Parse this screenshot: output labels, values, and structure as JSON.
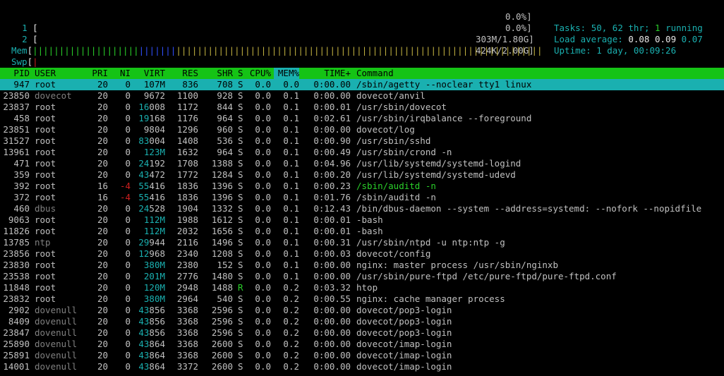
{
  "meters": {
    "cpu1": {
      "label": "1",
      "open": "[",
      "value": "0.0%]"
    },
    "cpu2": {
      "label": "2",
      "open": "[",
      "value": "0.0%]"
    },
    "mem": {
      "label": "Mem",
      "open": "[",
      "bars_green": "||||||||||||||||||||",
      "bars_blue": "|||||||",
      "bars_yellow": "|||||||||||||||||||||||||||||||||||||||||||||||||||||||||||||||||||||",
      "value": "303M/1.80G]"
    },
    "swp": {
      "label": "Swp",
      "open": "[",
      "bars_red": "|",
      "value": "424K/2.00G]"
    }
  },
  "stats": {
    "tasks_label": "Tasks: ",
    "tasks_value": "50, ",
    "thr_value": "62",
    "thr_label": " thr; ",
    "running_value": "1",
    "running_label": " running",
    "load_label": "Load average: ",
    "load1": "0.08",
    "load5": "0.09",
    "load15": "0.07",
    "uptime_label": "Uptime: ",
    "uptime_value": "1 day, 00:09:26"
  },
  "header": {
    "pid": "PID",
    "user": "USER",
    "pri": "PRI",
    "ni": "NI",
    "virt": "VIRT",
    "res": "RES",
    "shr": "SHR",
    "s": "S",
    "cpu": "CPU%",
    "mem": "MEM%",
    "time": "TIME+",
    "cmd": "Command"
  },
  "processes": [
    {
      "pid": "947",
      "user": "root",
      "pri": "20",
      "ni": "0",
      "virt": "107M",
      "res": "836",
      "shr": "708",
      "s": "S",
      "cpu": "0.0",
      "mem": "0.0",
      "time": "0:00.00",
      "cmd": "/sbin/agetty --noclear tty1 linux"
    },
    {
      "pid": "23850",
      "user": "dovecot",
      "pri": "20",
      "ni": "0",
      "virt": "9672",
      "res": "1100",
      "shr": "928",
      "s": "S",
      "cpu": "0.0",
      "mem": "0.1",
      "time": "0:00.00",
      "cmd": "dovecot/anvil"
    },
    {
      "pid": "23837",
      "user": "root",
      "pri": "20",
      "ni": "0",
      "virt": "16008",
      "res": "1172",
      "shr": "844",
      "s": "S",
      "cpu": "0.0",
      "mem": "0.1",
      "time": "0:00.01",
      "cmd": "/usr/sbin/dovecot"
    },
    {
      "pid": "458",
      "user": "root",
      "pri": "20",
      "ni": "0",
      "virt": "19168",
      "res": "1176",
      "shr": "964",
      "s": "S",
      "cpu": "0.0",
      "mem": "0.1",
      "time": "0:02.61",
      "cmd": "/usr/sbin/irqbalance --foreground"
    },
    {
      "pid": "23851",
      "user": "root",
      "pri": "20",
      "ni": "0",
      "virt": "9804",
      "res": "1296",
      "shr": "960",
      "s": "S",
      "cpu": "0.0",
      "mem": "0.1",
      "time": "0:00.00",
      "cmd": "dovecot/log"
    },
    {
      "pid": "31527",
      "user": "root",
      "pri": "20",
      "ni": "0",
      "virt": "83004",
      "res": "1408",
      "shr": "536",
      "s": "S",
      "cpu": "0.0",
      "mem": "0.1",
      "time": "0:00.90",
      "cmd": "/usr/sbin/sshd"
    },
    {
      "pid": "13961",
      "user": "root",
      "pri": "20",
      "ni": "0",
      "virt": "123M",
      "res": "1632",
      "shr": "964",
      "s": "S",
      "cpu": "0.0",
      "mem": "0.1",
      "time": "0:00.49",
      "cmd": "/usr/sbin/crond -n"
    },
    {
      "pid": "471",
      "user": "root",
      "pri": "20",
      "ni": "0",
      "virt": "24192",
      "res": "1708",
      "shr": "1388",
      "s": "S",
      "cpu": "0.0",
      "mem": "0.1",
      "time": "0:04.96",
      "cmd": "/usr/lib/systemd/systemd-logind"
    },
    {
      "pid": "359",
      "user": "root",
      "pri": "20",
      "ni": "0",
      "virt": "43472",
      "res": "1772",
      "shr": "1284",
      "s": "S",
      "cpu": "0.0",
      "mem": "0.1",
      "time": "0:00.20",
      "cmd": "/usr/lib/systemd/systemd-udevd"
    },
    {
      "pid": "392",
      "user": "root",
      "pri": "16",
      "ni": "-4",
      "virt": "55416",
      "res": "1836",
      "shr": "1396",
      "s": "S",
      "cpu": "0.0",
      "mem": "0.1",
      "time": "0:00.23",
      "cmd": "/sbin/auditd -n"
    },
    {
      "pid": "372",
      "user": "root",
      "pri": "16",
      "ni": "-4",
      "virt": "55416",
      "res": "1836",
      "shr": "1396",
      "s": "S",
      "cpu": "0.0",
      "mem": "0.1",
      "time": "0:01.76",
      "cmd": "/sbin/auditd -n"
    },
    {
      "pid": "460",
      "user": "dbus",
      "pri": "20",
      "ni": "0",
      "virt": "24528",
      "res": "1904",
      "shr": "1332",
      "s": "S",
      "cpu": "0.0",
      "mem": "0.1",
      "time": "0:12.43",
      "cmd": "/bin/dbus-daemon --system --address=systemd: --nofork --nopidfile"
    },
    {
      "pid": "9063",
      "user": "root",
      "pri": "20",
      "ni": "0",
      "virt": "112M",
      "res": "1988",
      "shr": "1612",
      "s": "S",
      "cpu": "0.0",
      "mem": "0.1",
      "time": "0:00.01",
      "cmd": "-bash"
    },
    {
      "pid": "11826",
      "user": "root",
      "pri": "20",
      "ni": "0",
      "virt": "112M",
      "res": "2032",
      "shr": "1656",
      "s": "S",
      "cpu": "0.0",
      "mem": "0.1",
      "time": "0:00.01",
      "cmd": "-bash"
    },
    {
      "pid": "13785",
      "user": "ntp",
      "pri": "20",
      "ni": "0",
      "virt": "29944",
      "res": "2116",
      "shr": "1496",
      "s": "S",
      "cpu": "0.0",
      "mem": "0.1",
      "time": "0:00.31",
      "cmd": "/usr/sbin/ntpd -u ntp:ntp -g"
    },
    {
      "pid": "23856",
      "user": "root",
      "pri": "20",
      "ni": "0",
      "virt": "12968",
      "res": "2340",
      "shr": "1208",
      "s": "S",
      "cpu": "0.0",
      "mem": "0.1",
      "time": "0:00.03",
      "cmd": "dovecot/config"
    },
    {
      "pid": "23830",
      "user": "root",
      "pri": "20",
      "ni": "0",
      "virt": "380M",
      "res": "2380",
      "shr": "152",
      "s": "S",
      "cpu": "0.0",
      "mem": "0.1",
      "time": "0:00.00",
      "cmd": "nginx: master process /usr/sbin/nginxb"
    },
    {
      "pid": "23538",
      "user": "root",
      "pri": "20",
      "ni": "0",
      "virt": "201M",
      "res": "2776",
      "shr": "1480",
      "s": "S",
      "cpu": "0.0",
      "mem": "0.1",
      "time": "0:00.00",
      "cmd": "/usr/sbin/pure-ftpd /etc/pure-ftpd/pure-ftpd.conf"
    },
    {
      "pid": "11848",
      "user": "root",
      "pri": "20",
      "ni": "0",
      "virt": "120M",
      "res": "2948",
      "shr": "1488",
      "s": "R",
      "cpu": "0.0",
      "mem": "0.2",
      "time": "0:03.32",
      "cmd": "htop"
    },
    {
      "pid": "23832",
      "user": "root",
      "pri": "20",
      "ni": "0",
      "virt": "380M",
      "res": "2964",
      "shr": "540",
      "s": "S",
      "cpu": "0.0",
      "mem": "0.2",
      "time": "0:00.55",
      "cmd": "nginx: cache manager process"
    },
    {
      "pid": "2902",
      "user": "dovenull",
      "pri": "20",
      "ni": "0",
      "virt": "43856",
      "res": "3368",
      "shr": "2596",
      "s": "S",
      "cpu": "0.0",
      "mem": "0.2",
      "time": "0:00.00",
      "cmd": "dovecot/pop3-login"
    },
    {
      "pid": "8409",
      "user": "dovenull",
      "pri": "20",
      "ni": "0",
      "virt": "43856",
      "res": "3368",
      "shr": "2596",
      "s": "S",
      "cpu": "0.0",
      "mem": "0.2",
      "time": "0:00.00",
      "cmd": "dovecot/pop3-login"
    },
    {
      "pid": "23847",
      "user": "dovenull",
      "pri": "20",
      "ni": "0",
      "virt": "43856",
      "res": "3368",
      "shr": "2596",
      "s": "S",
      "cpu": "0.0",
      "mem": "0.2",
      "time": "0:00.00",
      "cmd": "dovecot/pop3-login"
    },
    {
      "pid": "25890",
      "user": "dovenull",
      "pri": "20",
      "ni": "0",
      "virt": "43864",
      "res": "3368",
      "shr": "2600",
      "s": "S",
      "cpu": "0.0",
      "mem": "0.2",
      "time": "0:00.00",
      "cmd": "dovecot/imap-login"
    },
    {
      "pid": "25891",
      "user": "dovenull",
      "pri": "20",
      "ni": "0",
      "virt": "43864",
      "res": "3368",
      "shr": "2600",
      "s": "S",
      "cpu": "0.0",
      "mem": "0.2",
      "time": "0:00.00",
      "cmd": "dovecot/imap-login"
    },
    {
      "pid": "14001",
      "user": "dovenull",
      "pri": "20",
      "ni": "0",
      "virt": "43864",
      "res": "3372",
      "shr": "2600",
      "s": "S",
      "cpu": "0.0",
      "mem": "0.2",
      "time": "0:00.00",
      "cmd": "dovecot/imap-login"
    }
  ],
  "colors": {
    "header_bg": "#15c315",
    "selected_bg": "#1ab0b0",
    "accent": "#1ab0b0",
    "nonroot_user": "#808080",
    "negative_ni": "#d02020",
    "green_text": "#2ad02a"
  }
}
